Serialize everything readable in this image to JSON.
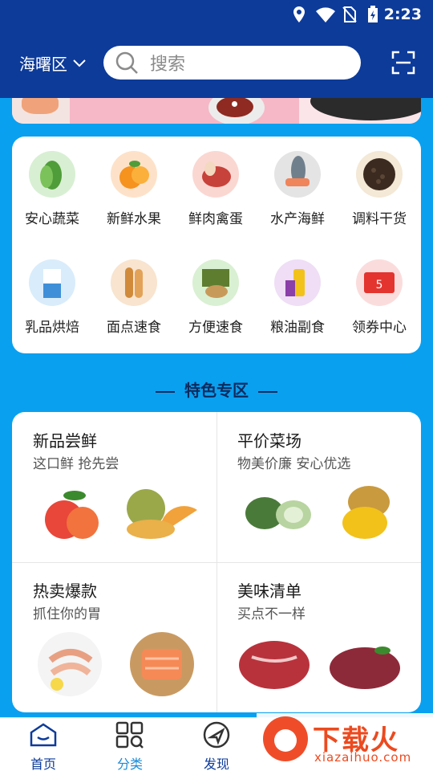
{
  "status_bar": {
    "time": "2:23"
  },
  "header": {
    "location": "海曙区",
    "search_placeholder": "搜索"
  },
  "categories": [
    {
      "label": "安心蔬菜",
      "icon": "vegetables-icon",
      "color": "#d8efd3"
    },
    {
      "label": "新鲜水果",
      "icon": "fruit-icon",
      "color": "#fde2c9"
    },
    {
      "label": "鲜肉禽蛋",
      "icon": "meat-egg-icon",
      "color": "#fbd7d2"
    },
    {
      "label": "水产海鲜",
      "icon": "seafood-icon",
      "color": "#e4e4e4"
    },
    {
      "label": "调料干货",
      "icon": "spices-icon",
      "color": "#f4e8d6"
    },
    {
      "label": "乳品烘焙",
      "icon": "dairy-icon",
      "color": "#d9ecfb"
    },
    {
      "label": "面点速食",
      "icon": "bread-icon",
      "color": "#f8e4cf"
    },
    {
      "label": "方便速食",
      "icon": "instant-food-icon",
      "color": "#d9f0d2"
    },
    {
      "label": "粮油副食",
      "icon": "grain-oil-icon",
      "color": "#efdef6"
    },
    {
      "label": "领券中心",
      "icon": "coupon-icon",
      "color": "#fbdcdc"
    }
  ],
  "section": {
    "title": "特色专区"
  },
  "features": [
    {
      "title": "新品尝鲜",
      "subtitle": "这口鲜 抢先尝",
      "images": [
        "peach-icon",
        "melon-icon"
      ]
    },
    {
      "title": "平价菜场",
      "subtitle": "物美价廉 安心优选",
      "images": [
        "wax-gourd-icon",
        "potato-icon"
      ]
    },
    {
      "title": "热卖爆款",
      "subtitle": "抓住你的胃",
      "images": [
        "shrimp-icon",
        "salmon-icon"
      ]
    },
    {
      "title": "美味清单",
      "subtitle": "买点不一样",
      "images": [
        "beef-icon",
        "steak-icon"
      ]
    }
  ],
  "tabs": [
    {
      "label": "首页",
      "icon": "home-icon"
    },
    {
      "label": "分类",
      "icon": "category-icon"
    },
    {
      "label": "发现",
      "icon": "discover-icon"
    }
  ],
  "watermark": {
    "cn": "下载火",
    "en": "xiazaihuo.com"
  },
  "colors": {
    "header": "#0d3b9a",
    "background": "#0aa0f0",
    "accent": "#0d3b9a"
  }
}
